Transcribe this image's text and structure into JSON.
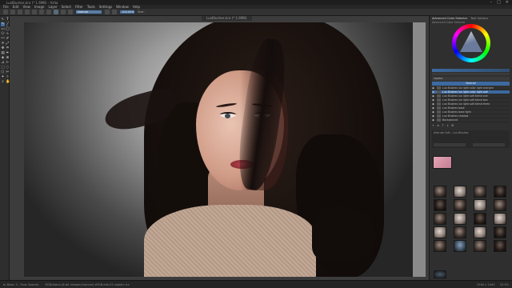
{
  "window": {
    "title": "LuxBlushes.kra (* 1.6MB) – Krita",
    "minimize": "–",
    "maximize": "□",
    "close": "✕"
  },
  "menu": [
    "File",
    "Edit",
    "View",
    "Image",
    "Layer",
    "Select",
    "Filter",
    "Tools",
    "Settings",
    "Window",
    "Help"
  ],
  "toolbar": {
    "blend_mode_value": "Normal",
    "opacity_value": "100.00%",
    "size_label": "Size:"
  },
  "document_tab": "LuxBlushes.kra (* 1.6MB)",
  "docker": {
    "tabs": [
      "Advanced Color Selector",
      "Tool Options"
    ],
    "active_tab_index": 0,
    "selector_subtitle": "Advanced Color Selector",
    "layers_header": "Layers",
    "blend_mode": "Normal",
    "layers": [
      "Lux Blushes lux light color light sharpen",
      "Lux Blushes lux light color light soft",
      "Lux Blushes lux light soft blend one",
      "Lux Blushes lux light soft blend two",
      "Lux Blushes lux light soft blend three",
      "Lux Blushes base",
      "Lux Blushes base light",
      "Lux Blushes shadow",
      "Background"
    ],
    "selected_layer_index": 1,
    "layer_footer_icons": [
      "+",
      "≡",
      "↑",
      "↓",
      "⚙"
    ],
    "brush_line": "Airbrush Soft – Lux Blushes",
    "preset_count": 19
  },
  "status": {
    "left": "b) Basic 3 - Flow Opacity",
    "center": "RGB/Alpha (8-bit integer/channel)  sRGB-elle-V2-srgbtrc.icc",
    "right_zoom": "33.3%",
    "right_size": "2560 x 1440"
  },
  "colors": {
    "selection_blue": "#3d6aa0",
    "panel_bg": "#2f2f2f",
    "preset_pink": "#e6a6b6"
  }
}
